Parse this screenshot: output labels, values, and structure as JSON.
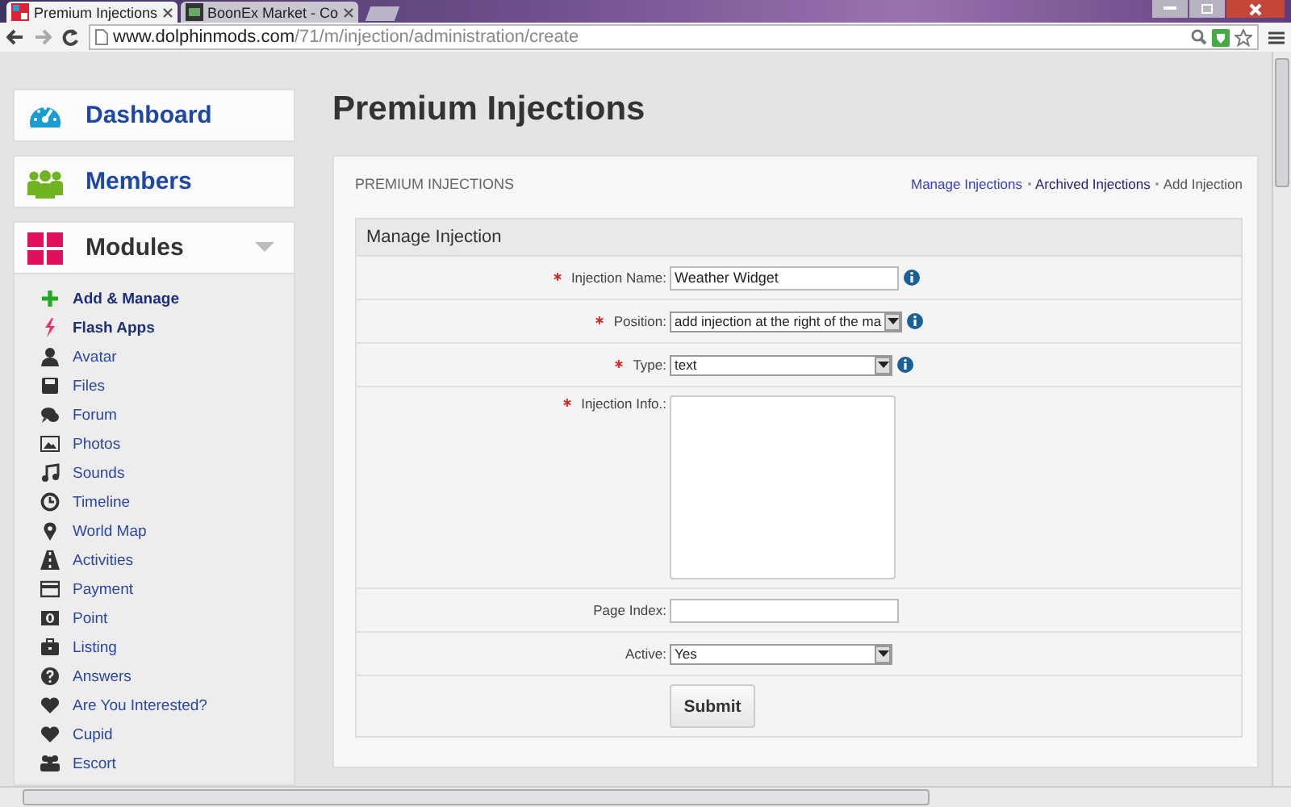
{
  "browser": {
    "tabs": [
      {
        "title": "Premium Injections",
        "selected": true
      },
      {
        "title": "BoonEx Market - Co",
        "selected": false
      }
    ],
    "url": {
      "host": "www.dolphinmods.com",
      "path": "/71/m/injection/administration/create"
    }
  },
  "sidebar": {
    "sections": [
      {
        "label": "Dashboard"
      },
      {
        "label": "Members"
      },
      {
        "label": "Modules",
        "items": [
          {
            "label": "Add & Manage",
            "kind": "action"
          },
          {
            "label": "Flash Apps",
            "kind": "action"
          },
          {
            "label": "Avatar",
            "kind": "module"
          },
          {
            "label": "Files",
            "kind": "module"
          },
          {
            "label": "Forum",
            "kind": "module"
          },
          {
            "label": "Photos",
            "kind": "module"
          },
          {
            "label": "Sounds",
            "kind": "module"
          },
          {
            "label": "Timeline",
            "kind": "module"
          },
          {
            "label": "World Map",
            "kind": "module"
          },
          {
            "label": "Activities",
            "kind": "module"
          },
          {
            "label": "Payment",
            "kind": "module"
          },
          {
            "label": "Point",
            "kind": "module"
          },
          {
            "label": "Listing",
            "kind": "module"
          },
          {
            "label": "Answers",
            "kind": "module"
          },
          {
            "label": "Are You Interested?",
            "kind": "module"
          },
          {
            "label": "Cupid",
            "kind": "module"
          },
          {
            "label": "Escort",
            "kind": "module"
          }
        ]
      }
    ]
  },
  "main": {
    "title": "Premium Injections",
    "panel": {
      "heading": "PREMIUM INJECTIONS",
      "links": [
        {
          "label": "Manage Injections",
          "kind": "link"
        },
        {
          "label": "Archived Injections",
          "kind": "visited"
        },
        {
          "label": "Add Injection",
          "kind": "current"
        }
      ],
      "form": {
        "title": "Manage Injection",
        "fields": [
          {
            "kind": "text",
            "label": "Injection Name:",
            "required": true,
            "info": true,
            "value": "Weather Widget"
          },
          {
            "kind": "select",
            "label": "Position:",
            "required": true,
            "info": true,
            "value": "add injection at the right of the ma"
          },
          {
            "kind": "select",
            "label": "Type:",
            "required": true,
            "info": true,
            "value": "text"
          },
          {
            "kind": "textarea",
            "label": "Injection Info.:",
            "required": true,
            "info": false
          },
          {
            "kind": "text",
            "label": "Page Index:",
            "required": false,
            "info": false
          },
          {
            "kind": "select",
            "label": "Active:",
            "required": false,
            "info": false,
            "value": "Yes"
          }
        ],
        "submit": "Submit"
      }
    }
  }
}
